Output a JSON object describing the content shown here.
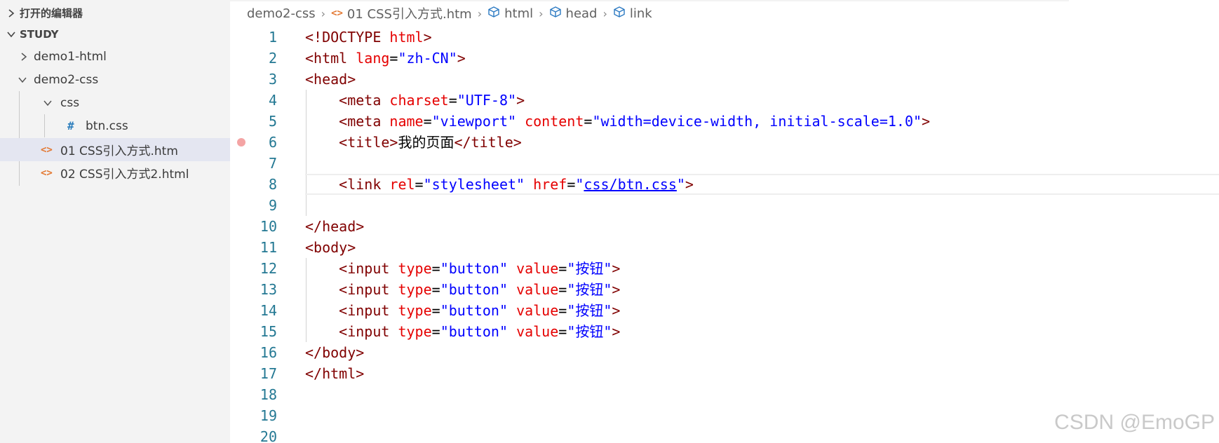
{
  "sidebar": {
    "open_editors_label": "打开的编辑器",
    "workspace_label": "STUDY",
    "items": [
      {
        "label": "demo1-html",
        "kind": "folder",
        "expanded": false
      },
      {
        "label": "demo2-css",
        "kind": "folder",
        "expanded": true
      },
      {
        "label": "css",
        "kind": "folder",
        "expanded": true
      },
      {
        "label": "btn.css",
        "kind": "css-file",
        "icon": "#"
      },
      {
        "label": "01 CSS引入方式.htm",
        "kind": "html-file",
        "icon": "<>",
        "selected": true
      },
      {
        "label": "02 CSS引入方式2.html",
        "kind": "html-file",
        "icon": "<>"
      }
    ]
  },
  "breadcrumb": {
    "items": [
      "demo2-css",
      "01 CSS引入方式.htm",
      "html",
      "head",
      "link"
    ],
    "html_icon": "<>"
  },
  "editor": {
    "active_line": 8,
    "breakpoint_line": 6,
    "line_numbers": [
      "1",
      "2",
      "3",
      "4",
      "5",
      "6",
      "7",
      "8",
      "9",
      "10",
      "11",
      "12",
      "13",
      "14",
      "15",
      "16",
      "17",
      "18",
      "19",
      "20"
    ],
    "lines": [
      [
        {
          "c": "t-tag",
          "t": "<!DOCTYPE "
        },
        {
          "c": "t-attr",
          "t": "html"
        },
        {
          "c": "t-tag",
          "t": ">"
        }
      ],
      [
        {
          "c": "t-tag",
          "t": "<html "
        },
        {
          "c": "t-attr",
          "t": "lang"
        },
        {
          "c": "t-plain",
          "t": "="
        },
        {
          "c": "t-str",
          "t": "\"zh-CN\""
        },
        {
          "c": "t-tag",
          "t": ">"
        }
      ],
      [
        {
          "c": "t-tag",
          "t": "<head>"
        }
      ],
      [
        {
          "c": "t-plain",
          "t": "    "
        },
        {
          "c": "t-tag",
          "t": "<meta "
        },
        {
          "c": "t-attr",
          "t": "charset"
        },
        {
          "c": "t-plain",
          "t": "="
        },
        {
          "c": "t-str",
          "t": "\"UTF-8\""
        },
        {
          "c": "t-tag",
          "t": ">"
        }
      ],
      [
        {
          "c": "t-plain",
          "t": "    "
        },
        {
          "c": "t-tag",
          "t": "<meta "
        },
        {
          "c": "t-attr",
          "t": "name"
        },
        {
          "c": "t-plain",
          "t": "="
        },
        {
          "c": "t-str",
          "t": "\"viewport\" "
        },
        {
          "c": "t-attr",
          "t": "content"
        },
        {
          "c": "t-plain",
          "t": "="
        },
        {
          "c": "t-str",
          "t": "\"width=device-width, initial-scale=1.0\""
        },
        {
          "c": "t-tag",
          "t": ">"
        }
      ],
      [
        {
          "c": "t-plain",
          "t": "    "
        },
        {
          "c": "t-tag",
          "t": "<title>"
        },
        {
          "c": "t-plain",
          "t": "我的页面"
        },
        {
          "c": "t-tag",
          "t": "</title>"
        }
      ],
      [],
      [
        {
          "c": "t-plain",
          "t": "    "
        },
        {
          "c": "t-tag",
          "t": "<link "
        },
        {
          "c": "t-attr",
          "t": "rel"
        },
        {
          "c": "t-plain",
          "t": "="
        },
        {
          "c": "t-str",
          "t": "\"stylesheet\" "
        },
        {
          "c": "t-attr",
          "t": "href"
        },
        {
          "c": "t-plain",
          "t": "="
        },
        {
          "c": "t-str",
          "t": "\""
        },
        {
          "c": "t-link",
          "t": "css/btn.css"
        },
        {
          "c": "t-str",
          "t": "\""
        },
        {
          "c": "t-tag",
          "t": ">"
        }
      ],
      [],
      [
        {
          "c": "t-tag",
          "t": "</head>"
        }
      ],
      [
        {
          "c": "t-tag",
          "t": "<body>"
        }
      ],
      [
        {
          "c": "t-plain",
          "t": "    "
        },
        {
          "c": "t-tag",
          "t": "<input "
        },
        {
          "c": "t-attr",
          "t": "type"
        },
        {
          "c": "t-plain",
          "t": "="
        },
        {
          "c": "t-str",
          "t": "\"button\" "
        },
        {
          "c": "t-attr",
          "t": "value"
        },
        {
          "c": "t-plain",
          "t": "="
        },
        {
          "c": "t-str",
          "t": "\"按钮\""
        },
        {
          "c": "t-tag",
          "t": ">"
        }
      ],
      [
        {
          "c": "t-plain",
          "t": "    "
        },
        {
          "c": "t-tag",
          "t": "<input "
        },
        {
          "c": "t-attr",
          "t": "type"
        },
        {
          "c": "t-plain",
          "t": "="
        },
        {
          "c": "t-str",
          "t": "\"button\" "
        },
        {
          "c": "t-attr",
          "t": "value"
        },
        {
          "c": "t-plain",
          "t": "="
        },
        {
          "c": "t-str",
          "t": "\"按钮\""
        },
        {
          "c": "t-tag",
          "t": ">"
        }
      ],
      [
        {
          "c": "t-plain",
          "t": "    "
        },
        {
          "c": "t-tag",
          "t": "<input "
        },
        {
          "c": "t-attr",
          "t": "type"
        },
        {
          "c": "t-plain",
          "t": "="
        },
        {
          "c": "t-str",
          "t": "\"button\" "
        },
        {
          "c": "t-attr",
          "t": "value"
        },
        {
          "c": "t-plain",
          "t": "="
        },
        {
          "c": "t-str",
          "t": "\"按钮\""
        },
        {
          "c": "t-tag",
          "t": ">"
        }
      ],
      [
        {
          "c": "t-plain",
          "t": "    "
        },
        {
          "c": "t-tag",
          "t": "<input "
        },
        {
          "c": "t-attr",
          "t": "type"
        },
        {
          "c": "t-plain",
          "t": "="
        },
        {
          "c": "t-str",
          "t": "\"button\" "
        },
        {
          "c": "t-attr",
          "t": "value"
        },
        {
          "c": "t-plain",
          "t": "="
        },
        {
          "c": "t-str",
          "t": "\"按钮\""
        },
        {
          "c": "t-tag",
          "t": ">"
        }
      ],
      [
        {
          "c": "t-tag",
          "t": "</body>"
        }
      ],
      [
        {
          "c": "t-tag",
          "t": "</html>"
        }
      ],
      [],
      [],
      []
    ]
  },
  "watermark": "CSDN @EmoGP",
  "colors": {
    "tag": "#800000",
    "attribute": "#e50000",
    "string": "#0000ff",
    "line_number": "#237893",
    "sidebar_bg": "#f3f3f3",
    "selected_bg": "#e4e6f1",
    "breakpoint": "#f4a4a4"
  }
}
